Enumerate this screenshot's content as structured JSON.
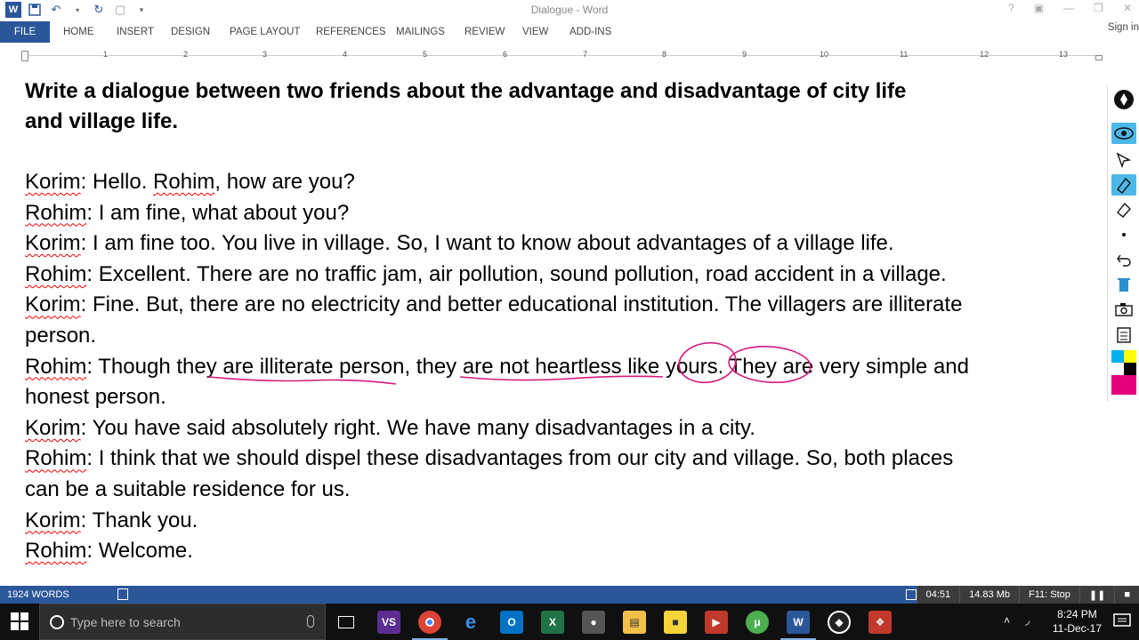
{
  "window": {
    "title": "Dialogue - Word"
  },
  "ribbon": {
    "tabs": [
      "FILE",
      "HOME",
      "INSERT",
      "DESIGN",
      "PAGE LAYOUT",
      "REFERENCES",
      "MAILINGS",
      "REVIEW",
      "VIEW",
      "ADD-INS"
    ],
    "sign_in": "Sign in"
  },
  "ruler": {
    "numbers": [
      "1",
      "2",
      "3",
      "4",
      "5",
      "6",
      "7",
      "8",
      "9",
      "10",
      "11",
      "12",
      "13"
    ]
  },
  "document": {
    "heading_line1": "Write a dialogue between two friends about the advantage and disadvantage of city life",
    "heading_line2": "and village life.",
    "lines": [
      {
        "speaker": "Korim",
        "text": ": Hello. "
      },
      {
        "speaker": "Rohim",
        "text": ": I am fine, what about you?"
      },
      {
        "speaker": "Korim",
        "text": ": I am fine too. You live in village. So, I want to know about advantages of a village life."
      },
      {
        "speaker": "Rohim",
        "text": ": Excellent. There are no traffic jam, air pollution, sound pollution, road accident in a village."
      },
      {
        "speaker": "Korim",
        "text": ": Fine. But, there are no electricity and better educational institution. The villagers are illiterate"
      },
      {
        "speaker": "",
        "text": "person."
      },
      {
        "speaker": "Rohim",
        "text": ": Though they are illiterate person, they are not heartless like yours. They are very simple and"
      },
      {
        "speaker": "",
        "text": "honest person."
      },
      {
        "speaker": "Korim",
        "text": ": You have said absolutely right. We have many disadvantages in a city."
      },
      {
        "speaker": "Rohim",
        "text": ": I think that we should dispel these disadvantages from our city and village. So, both places"
      },
      {
        "speaker": "",
        "text": "can be a suitable residence for us."
      },
      {
        "speaker": "Korim",
        "text": ": Thank you."
      },
      {
        "speaker": "Rohim",
        "text": ": Welcome."
      }
    ],
    "line1_mid_name": "Rohim",
    "line1_tail": ", how are you?"
  },
  "status_bar": {
    "word_count": "1924 WORDS",
    "recorder_time": "04:51",
    "recorder_size": "14.83 Mb",
    "recorder_hint": "F11: Stop"
  },
  "taskbar": {
    "search_placeholder": "Type here to search",
    "time": "8:24 PM",
    "date": "11-Dec-17"
  },
  "colors": {
    "word_blue": "#2b579a",
    "ink_pink": "#d6197d",
    "toolbar_active": "#4db8e8"
  }
}
